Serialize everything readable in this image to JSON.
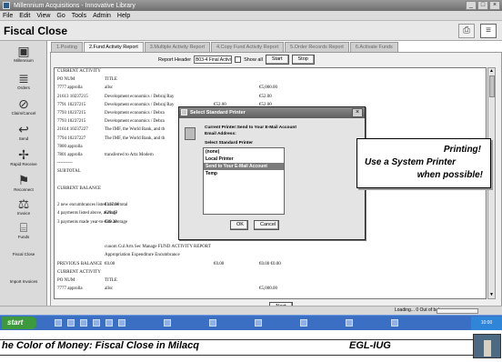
{
  "window": {
    "title": "Millennium Acquisitions - Innovative Library",
    "controls": [
      "_",
      "□",
      "×"
    ]
  },
  "menu": [
    "File",
    "Edit",
    "View",
    "Go",
    "Tools",
    "Admin",
    "Help"
  ],
  "header": {
    "title": "Fiscal Close",
    "print_label": "Print"
  },
  "sidebar": [
    {
      "name": "millennium",
      "label": "Millennium",
      "icon": "▣"
    },
    {
      "name": "orders",
      "label": "Orders",
      "icon": "≣"
    },
    {
      "name": "claim-cancel",
      "label": "Claim/Cancel",
      "icon": "⊘"
    },
    {
      "name": "send",
      "label": "Send",
      "icon": "↩"
    },
    {
      "name": "rapid-receive",
      "label": "Rapid Receive",
      "icon": "✢"
    },
    {
      "name": "reconnect",
      "label": "Reconnect",
      "icon": "⚑"
    },
    {
      "name": "invoice",
      "label": "Invoice",
      "icon": "⚖"
    },
    {
      "name": "funds",
      "label": "Funds",
      "icon": "⌸"
    },
    {
      "name": "fiscal-close",
      "label": "Fiscal Close",
      "icon": ""
    },
    {
      "name": "import-invoices",
      "label": "Import Invoices",
      "icon": ""
    }
  ],
  "tabs": [
    "1.Posting",
    "2.Fund Activity Report",
    "3.Multiple Activity Report",
    "4.Copy Fund Activity Report",
    "5.Order Records Report",
    "6.Activate Funds"
  ],
  "controls": {
    "report_header_label": "Report Header",
    "report_header_value": "B03-4 Final Activity",
    "show_all_label": "Show all",
    "start": "Start",
    "stop": "Stop",
    "next": "Next"
  },
  "report": {
    "lines": [
      {
        "cols": [
          "CURRENT ACTIVITY"
        ]
      },
      {
        "cols": [
          "PO NUM",
          "TITLE"
        ]
      },
      {
        "cols": [
          "7777 approlla",
          "allsc",
          "",
          "€5,000.00"
        ]
      },
      {
        "cols": [
          "21613 10237215",
          "Development economics / Debraj Ray",
          "",
          "€52.00"
        ]
      },
      {
        "cols": [
          "7791 10237215",
          "Development economics / Debraj Ray",
          "€52.00",
          "€52.00"
        ]
      },
      {
        "cols": [
          "7793 10237215",
          "Development economics / Debra",
          "",
          "€52.00"
        ]
      },
      {
        "cols": [
          "7793 10237215",
          "Development economics / Debra",
          "",
          "€52.00"
        ]
      },
      {
        "cols": [
          "21614 10237227",
          "The IMF, the World Bank, and th",
          "",
          ""
        ]
      },
      {
        "cols": [
          "7794 10237227",
          "The IMF, the World Bank, and th",
          "",
          ""
        ]
      },
      {
        "cols": [
          "7800 approlla",
          "",
          "",
          ""
        ]
      },
      {
        "cols": [
          "7801 approlla",
          "transferred to Artz Modern",
          "",
          ""
        ]
      },
      {
        "cols": [
          "----------",
          "",
          "",
          ""
        ]
      },
      {
        "cols": [
          "SUBTOTAL",
          "",
          "",
          ""
        ]
      },
      {
        "cols": [
          "",
          "",
          "",
          ""
        ]
      },
      {
        "cols": [
          "CURRENT BALANCE",
          "",
          "€382",
          ""
        ]
      },
      {
        "cols": [
          "",
          "",
          "",
          ""
        ]
      },
      {
        "cols": [
          "2  new encumbrances listed above total",
          "€117.90",
          "",
          ""
        ]
      },
      {
        "cols": [
          "4  payments listed above, average",
          "€29.47",
          "",
          ""
        ]
      },
      {
        "cols": [
          "3  payments made year-to-date average",
          "€39.30",
          "",
          ""
        ]
      },
      {
        "cols": [
          "",
          "",
          "",
          ""
        ]
      },
      {
        "cols": [
          "",
          "",
          "",
          ""
        ]
      },
      {
        "cols": [
          "",
          "cuuom Cul Arts Sec Manage FUND ACTIVITY REPORT",
          "",
          ""
        ]
      },
      {
        "cols": [
          "",
          "Appropriation    Expenditure    Encumbrance",
          "",
          ""
        ]
      },
      {
        "cols": [
          "PREVIOUS BALANCE",
          "€0.00",
          "€0.00",
          "€0.00     €0.00"
        ]
      },
      {
        "cols": [
          "CURRENT ACTIVITY"
        ]
      },
      {
        "cols": [
          "PO NUM",
          "TITLE"
        ]
      },
      {
        "cols": [
          "7777 approlla",
          "allsc",
          "",
          "€5,000.00"
        ]
      }
    ]
  },
  "dialog": {
    "title": "Select Standard Printer",
    "current_label": "Current Printer:Send to Your E-Mail Account",
    "email_label": "Email Address:",
    "select_label": "Select Standard Printer",
    "options": [
      "(none)",
      "Local Printer",
      "Send to Your E-Mail Account",
      "Temp"
    ],
    "selected_index": 2,
    "ok": "OK",
    "cancel": "Cancel",
    "close": "×"
  },
  "status": {
    "text": "Loading... 0 Out of balance"
  },
  "taskbar": {
    "start": "start",
    "clock": "10:00"
  },
  "callout": {
    "line1": "Printing!",
    "line2": "Use a System Printer",
    "line3": "when possible!"
  },
  "footer": {
    "title": "he Color of Money: Fiscal Close in Milacq",
    "org": "EGL-IUG"
  },
  "colors": {
    "taskbar": "#3b6fc4",
    "start": "#3c9a3c",
    "selected_option": "#7c7c7c"
  }
}
